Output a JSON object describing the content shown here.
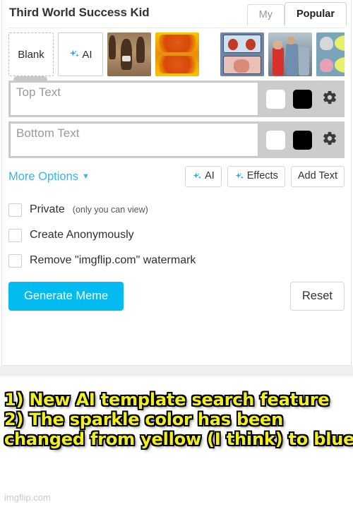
{
  "header": {
    "template_title": "Third World Success Kid",
    "tabs": [
      {
        "label": "My",
        "active": false
      },
      {
        "label": "Popular",
        "active": true
      }
    ]
  },
  "template_strip": {
    "blank_label": "Blank",
    "ai_label": "AI",
    "thumbnails": [
      {
        "name": "third-world-success-kid"
      },
      {
        "name": "hide-the-pain-orange"
      },
      {
        "name": "two-buttons"
      },
      {
        "name": "distracted-boyfriend"
      },
      {
        "name": "monkey-puppet"
      },
      {
        "name": "partial-template"
      }
    ]
  },
  "text_fields": [
    {
      "placeholder": "Top Text",
      "value": "",
      "outline_color": "#ffffff",
      "fill_color": "#000000",
      "settings_icon": "gear-icon"
    },
    {
      "placeholder": "Bottom Text",
      "value": "",
      "outline_color": "#ffffff",
      "fill_color": "#000000",
      "settings_icon": "gear-icon"
    }
  ],
  "options": {
    "more_options_label": "More Options",
    "caret": "▼",
    "buttons": [
      {
        "label": "AI",
        "icon": "sparkle-icon"
      },
      {
        "label": "Effects",
        "icon": "sparkle-icon"
      },
      {
        "label": "Add Text",
        "icon": ""
      }
    ]
  },
  "checkboxes": [
    {
      "label": "Private",
      "sub_label": "(only you can view)",
      "checked": false
    },
    {
      "label": "Create Anonymously",
      "sub_label": "",
      "checked": false
    },
    {
      "label": "Remove \"imgflip.com\" watermark",
      "sub_label": "",
      "checked": false
    }
  ],
  "footer": {
    "generate_label": "Generate Meme",
    "reset_label": "Reset"
  },
  "caption": {
    "line1": "1) New AI template search feature",
    "line2": "2) The sparkle color has been",
    "line3": "changed from yellow (I think) to blue"
  },
  "watermark": "imgflip.com",
  "colors": {
    "accent_blue": "#03BAF1",
    "link_blue": "#3BB4E5",
    "sparkle_blue": "#29ABE2",
    "caption_yellow": "#F2F01B",
    "text_row_bg": "#cccccc"
  }
}
